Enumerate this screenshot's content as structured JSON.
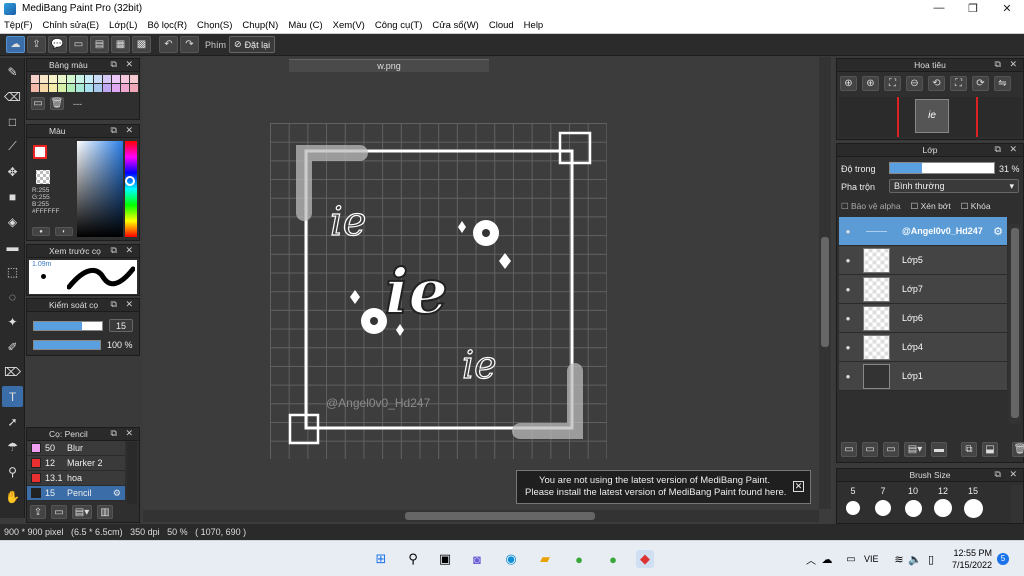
{
  "window": {
    "title": "MediBang Paint Pro (32bit)",
    "minimize": "—",
    "maximize": "❐",
    "close": "✕"
  },
  "menu": [
    "Tệp(F)",
    "Chỉnh sửa(E)",
    "Lớp(L)",
    "Bộ lọc(R)",
    "Chọn(S)",
    "Chụp(N)",
    "Màu (C)",
    "Xem(V)",
    "Công cụ(T)",
    "Cửa sổ(W)",
    "Cloud",
    "Help"
  ],
  "toolbar": {
    "phim_label": "Phím",
    "reset_label": "Đặt lại"
  },
  "palette": {
    "title": "Bảng màu",
    "name": "---",
    "colors": [
      "#f6d0c8",
      "#f8e6c8",
      "#f8f2c8",
      "#e6f6c8",
      "#d2f6d0",
      "#c8f2e6",
      "#c8ecf6",
      "#c8dcf6",
      "#d6c8f6",
      "#ecc8f6",
      "#f6c8e0",
      "#f6c8d0",
      "#f2b8a8",
      "#f6d8a8",
      "#f6ecaa",
      "#d6f0a8",
      "#b2eeb8",
      "#a8e8d6",
      "#a8e0f0",
      "#a8c8f0",
      "#c0a8f0",
      "#e0a8f0",
      "#f0a8d0",
      "#f0a8b8"
    ]
  },
  "color": {
    "title": "Màu",
    "r": "R:255",
    "g": "G:255",
    "b": "B:255",
    "hex": "#FFFFFF"
  },
  "preview": {
    "title": "Xem trước cọ",
    "size": "1.09m"
  },
  "control": {
    "title": "Kiểm soát cọ",
    "size": "15",
    "opacity": "100 %",
    "size_fraction": 0.7,
    "opacity_fraction": 1.0
  },
  "brushes": {
    "title": "Cọ: Pencil",
    "items": [
      {
        "size": "50",
        "name": "Blur",
        "color": "#f0a0f0"
      },
      {
        "size": "12",
        "name": "Marker 2",
        "color": "#e83030"
      },
      {
        "size": "13.1",
        "name": "hoa",
        "color": "#e83030"
      },
      {
        "size": "15",
        "name": "Pencil",
        "color": "#222222"
      }
    ]
  },
  "canvas": {
    "tab": "w.png",
    "watermark": "@Angel0v0_Hd247"
  },
  "navigator": {
    "title": "Hoa tiêu"
  },
  "layers": {
    "title": "Lớp",
    "opacity_label": "Độ trong",
    "opacity_value": "31 %",
    "opacity_fraction": 0.31,
    "blend_label": "Pha trộn",
    "blend_value": "Bình thường",
    "protect_alpha": "Bảo vệ alpha",
    "clip": "Xén bớt",
    "lock": "Khóa",
    "items": [
      {
        "name": "@Angel0v0_Hd247"
      },
      {
        "name": "Lớp5"
      },
      {
        "name": "Lớp7"
      },
      {
        "name": "Lớp6"
      },
      {
        "name": "Lớp4"
      },
      {
        "name": "Lớp1"
      }
    ]
  },
  "brush_size": {
    "title": "Brush Size",
    "sizes": [
      "5",
      "7",
      "10",
      "12",
      "15"
    ]
  },
  "notification": {
    "line1": "You are not using the latest version of MediBang Paint.",
    "line2": "Please install the latest version of MediBang Paint found here."
  },
  "status": {
    "text": "900 * 900 pixel   (6.5 * 6.5cm)   350 dpi   50 %   ( 1070, 690 )"
  },
  "taskbar": {
    "lang": "VIE",
    "time": "12:55 PM",
    "date": "7/15/2022",
    "badge": "5"
  }
}
